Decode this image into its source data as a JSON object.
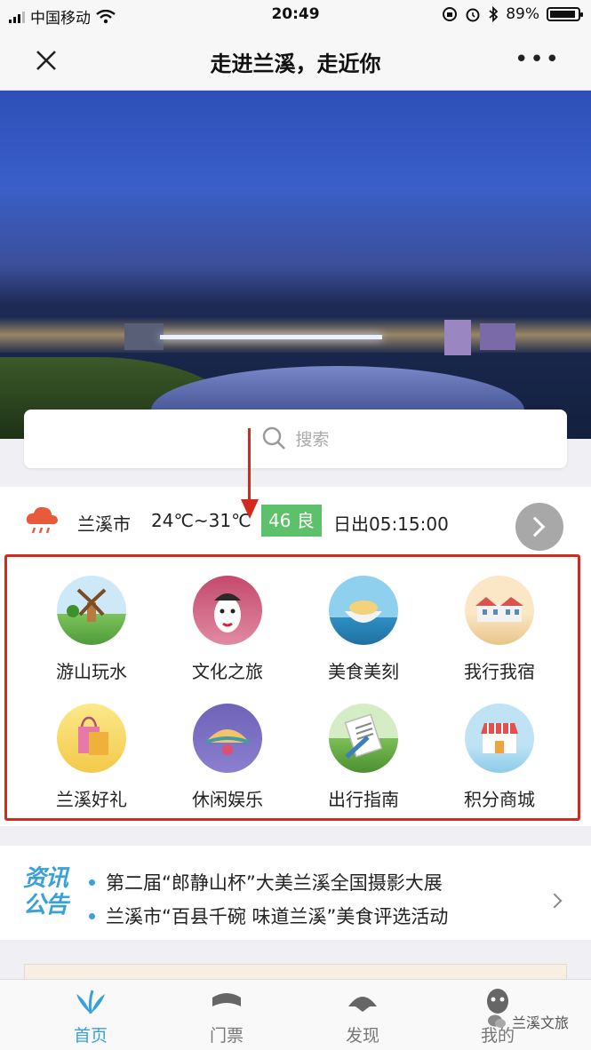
{
  "status_bar": {
    "carrier": "中国移动",
    "time": "20:49",
    "battery": "89%"
  },
  "nav": {
    "title": "走进兰溪，走近你",
    "close_icon": "close-icon",
    "more_icon": "more-icon"
  },
  "banner": {
    "slides_total": 5,
    "active_slide": 2
  },
  "search": {
    "placeholder": "搜索"
  },
  "weather": {
    "city": "兰溪市",
    "temperature": "24℃~31℃",
    "aqi": "46 良",
    "sunrise": "日出05:15:00",
    "accent": "#5cc16a"
  },
  "categories": [
    {
      "label": "游山玩水",
      "icon": "windmill-icon"
    },
    {
      "label": "文化之旅",
      "icon": "opera-mask-icon"
    },
    {
      "label": "美食美刻",
      "icon": "food-bowl-icon"
    },
    {
      "label": "我行我宿",
      "icon": "hotel-icon"
    },
    {
      "label": "兰溪好礼",
      "icon": "gift-bag-icon"
    },
    {
      "label": "休闲娱乐",
      "icon": "fan-icon"
    },
    {
      "label": "出行指南",
      "icon": "map-guide-icon"
    },
    {
      "label": "积分商城",
      "icon": "shop-icon"
    }
  ],
  "news": {
    "logo_line1": "资讯",
    "logo_line2": "公告",
    "items": [
      "第二届“郎静山杯”大美兰溪全国摄影大展",
      "兰溪市“百县千碗 味道兰溪”美食评选活动"
    ]
  },
  "tabbar": {
    "tabs": [
      {
        "label": "首页",
        "icon": "home-orchid-icon",
        "active": true
      },
      {
        "label": "门票",
        "icon": "ticket-icon",
        "active": false
      },
      {
        "label": "发现",
        "icon": "discover-fan-icon",
        "active": false
      },
      {
        "label": "我的",
        "icon": "profile-mask-icon",
        "active": false
      }
    ]
  },
  "watermark": "兰溪文旅",
  "colors": {
    "annotation": "#d42a1e",
    "brand_blue": "#3aa0d8"
  }
}
